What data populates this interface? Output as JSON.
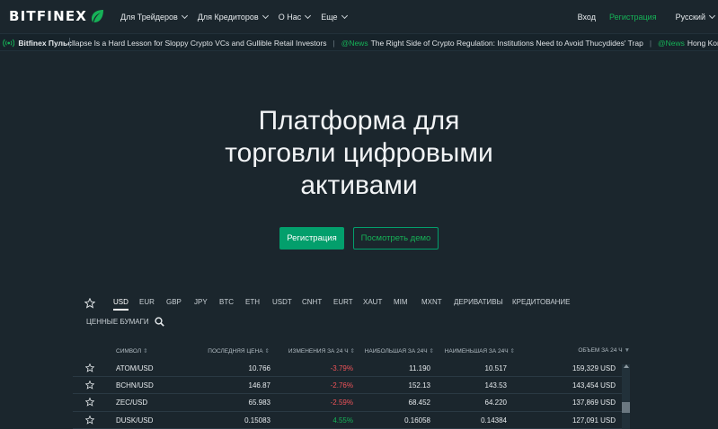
{
  "brand": {
    "logo_text": "BITFINEX",
    "accent_color": "#16b157",
    "button_color": "#039f6c",
    "negative_color": "#f05359"
  },
  "nav": {
    "items": [
      {
        "label": "Для Трейдеров"
      },
      {
        "label": "Для Кредиторов"
      },
      {
        "label": "О Нас"
      },
      {
        "label": "Еще"
      }
    ],
    "login": "Вход",
    "signup": "Регистрация",
    "language": "Русский"
  },
  "ticker": {
    "label": "Bitfinex Пульс",
    "items": [
      {
        "tag": "",
        "text": "llapse Is a Hard Lesson for Sloppy Crypto VCs and Gullible Retail Investors"
      },
      {
        "tag": "@News",
        "text": "The Right Side of Crypto Regulation: Institutions Need to Avoid Thucydides' Trap"
      },
      {
        "tag": "@News",
        "text": "Hong Kong university to ina"
      }
    ]
  },
  "hero": {
    "title_line1": "Платформа для",
    "title_line2": "торговли цифровыми",
    "title_line3": "активами",
    "signup_button": "Регистрация",
    "demo_button": "Посмотреть демо"
  },
  "market": {
    "tabs": [
      "USD",
      "EUR",
      "GBP",
      "JPY",
      "BTC",
      "ETH",
      "USDT",
      "CNHT",
      "EURT",
      "XAUT",
      "MIM",
      "MXNT",
      "ДЕРИВАТИВЫ",
      "КРЕДИТОВАНИЕ",
      "ЦЕННЫЕ БУМАГИ"
    ],
    "active_tab": "USD",
    "columns": {
      "symbol": "СИМВОЛ",
      "last": "ПОСЛЕДНЯЯ ЦЕНА",
      "change": "ИЗМЕНЕНИЯ ЗА 24 Ч",
      "high": "НАИБОЛЬШАЯ ЗА 24Ч",
      "low": "НАИМЕНЬШАЯ ЗА 24Ч",
      "volume": "ОБЪЕМ ЗА 24 Ч"
    },
    "rows": [
      {
        "symbol": "ATOM/USD",
        "last": "10.766",
        "change": "-3.79%",
        "high": "11.190",
        "low": "10.517",
        "volume": "159,329 USD"
      },
      {
        "symbol": "BCHN/USD",
        "last": "146.87",
        "change": "-2.76%",
        "high": "152.13",
        "low": "143.53",
        "volume": "143,454 USD"
      },
      {
        "symbol": "ZEC/USD",
        "last": "65.983",
        "change": "-2.59%",
        "high": "68.452",
        "low": "64.220",
        "volume": "137,869 USD"
      },
      {
        "symbol": "DUSK/USD",
        "last": "0.15083",
        "change": "4.55%",
        "high": "0.16058",
        "low": "0.14384",
        "volume": "127,091 USD"
      }
    ]
  }
}
